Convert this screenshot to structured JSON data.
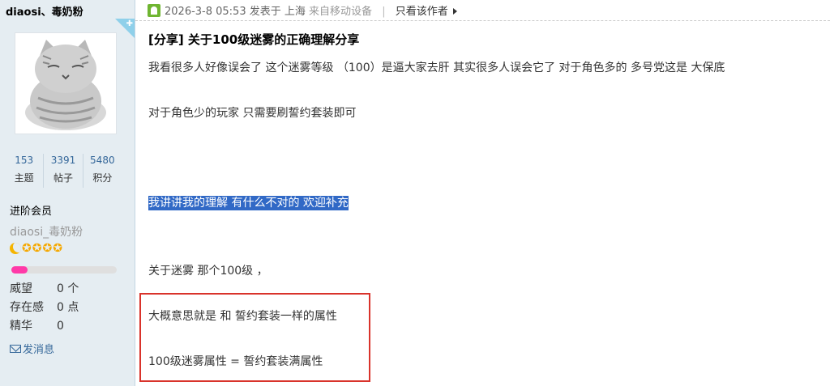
{
  "sidebar": {
    "username": "diaosi、毒奶粉",
    "stats": [
      {
        "num": "153",
        "label": "主题"
      },
      {
        "num": "3391",
        "label": "帖子"
      },
      {
        "num": "5480",
        "label": "积分"
      }
    ],
    "rank": "进阶会员",
    "nickname": "diaosi_毒奶粉",
    "progress_fraction": 0.15,
    "fields": [
      {
        "k": "威望",
        "v": "0 个"
      },
      {
        "k": "存在感",
        "v": "0 点"
      },
      {
        "k": "精华",
        "v": "0"
      }
    ],
    "send_message": "发消息"
  },
  "post": {
    "date": "2026-3-8 05:53",
    "posted_in": "发表于 上海",
    "device": "来自移动设备",
    "author_only": "只看该作者",
    "title": "[分享] 关于100级迷雾的正确理解分享",
    "lines": [
      "我看很多人好像误会了 这个迷雾等级 （100）是逼大家去肝 其实很多人误会它了  对于角色多的 多号党这是 大保底",
      "对于角色少的玩家 只需要刷誓约套装即可",
      "我讲讲我的理解 有什么不对的 欢迎补充",
      "关于迷雾 那个100级  ，",
      "大概意思就是 和 誓约套装一样的属性",
      "100级迷雾属性 = 誓约套装满属性"
    ]
  },
  "colors": {
    "sidebar_bg": "#e5edf2",
    "highlight": "#3169c6",
    "annotation_red": "#d9332b",
    "progress_pink": "#ff3aa8"
  }
}
